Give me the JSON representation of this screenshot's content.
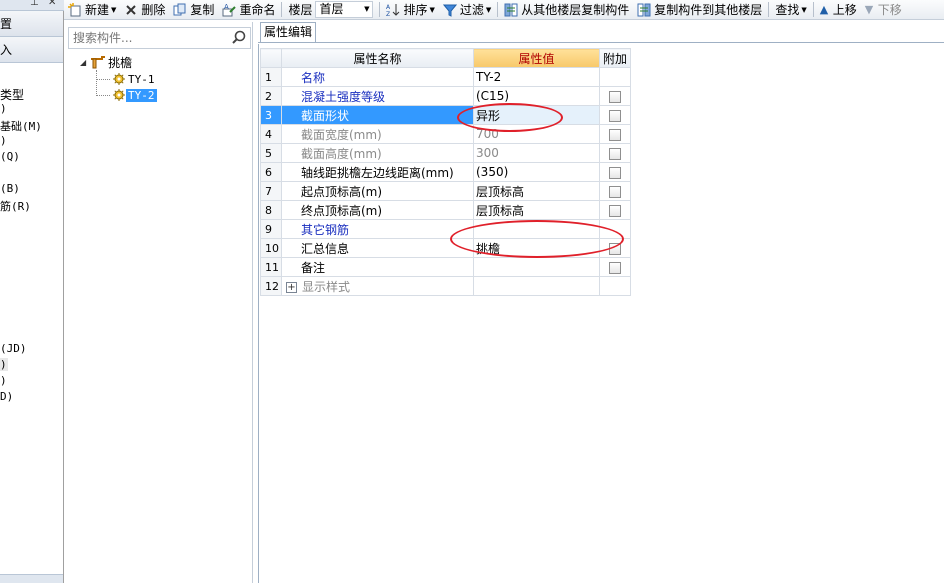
{
  "left_panel": {
    "header_button_1": "置",
    "header_button_2": "入",
    "items": [
      "类型",
      ")",
      "基础(M)",
      ")",
      "(Q)",
      "(B)",
      "筋(R)",
      "(JD)",
      ")",
      ")",
      "D)"
    ]
  },
  "toolbar": {
    "new_label": "新建",
    "delete_label": "删除",
    "copy_label": "复制",
    "rename_label": "重命名",
    "floor_label": "楼层",
    "floor_value": "首层",
    "sort_label": "排序",
    "filter_label": "过滤",
    "copy_from_floor_label": "从其他楼层复制构件",
    "copy_to_floor_label": "复制构件到其他楼层",
    "find_label": "查找",
    "move_up_label": "上移",
    "move_down_label": "下移"
  },
  "tree": {
    "search_placeholder": "搜索构件...",
    "root_label": "挑檐",
    "children": [
      "TY-1",
      "TY-2"
    ],
    "selected": "TY-2"
  },
  "properties": {
    "tab_label": "属性编辑",
    "headers": {
      "name": "属性名称",
      "value": "属性值",
      "extra": "附加"
    },
    "rows": [
      {
        "index": "1",
        "name": "名称",
        "value": "TY-2",
        "style": "blue",
        "checkbox": false
      },
      {
        "index": "2",
        "name": "混凝土强度等级",
        "value": "(C15)",
        "style": "blue",
        "checkbox": true
      },
      {
        "index": "3",
        "name": "截面形状",
        "value": "异形",
        "style": "blue",
        "checkbox": true
      },
      {
        "index": "4",
        "name": "截面宽度(mm)",
        "value": "700",
        "style": "gray",
        "checkbox": true
      },
      {
        "index": "5",
        "name": "截面高度(mm)",
        "value": "300",
        "style": "gray",
        "checkbox": true
      },
      {
        "index": "6",
        "name": "轴线距挑檐左边线距离(mm)",
        "value": "(350)",
        "style": "black",
        "checkbox": true
      },
      {
        "index": "7",
        "name": "起点顶标高(m)",
        "value": "层顶标高",
        "style": "black",
        "checkbox": true
      },
      {
        "index": "8",
        "name": "终点顶标高(m)",
        "value": "层顶标高",
        "style": "black",
        "checkbox": true
      },
      {
        "index": "9",
        "name": "其它钢筋",
        "value": "",
        "style": "blue",
        "checkbox": false
      },
      {
        "index": "10",
        "name": "汇总信息",
        "value": "挑檐",
        "style": "black",
        "checkbox": true
      },
      {
        "index": "11",
        "name": "备注",
        "value": "",
        "style": "black",
        "checkbox": true
      },
      {
        "index": "12",
        "name": "显示样式",
        "value": "",
        "style": "gray",
        "checkbox": false,
        "expandable": true
      }
    ],
    "selected_index": "3"
  },
  "colors": {
    "selection": "#3399ff",
    "property_blue": "#1a2fbf",
    "annotation_red": "#e0202a",
    "value_header": "#f7c86a"
  }
}
